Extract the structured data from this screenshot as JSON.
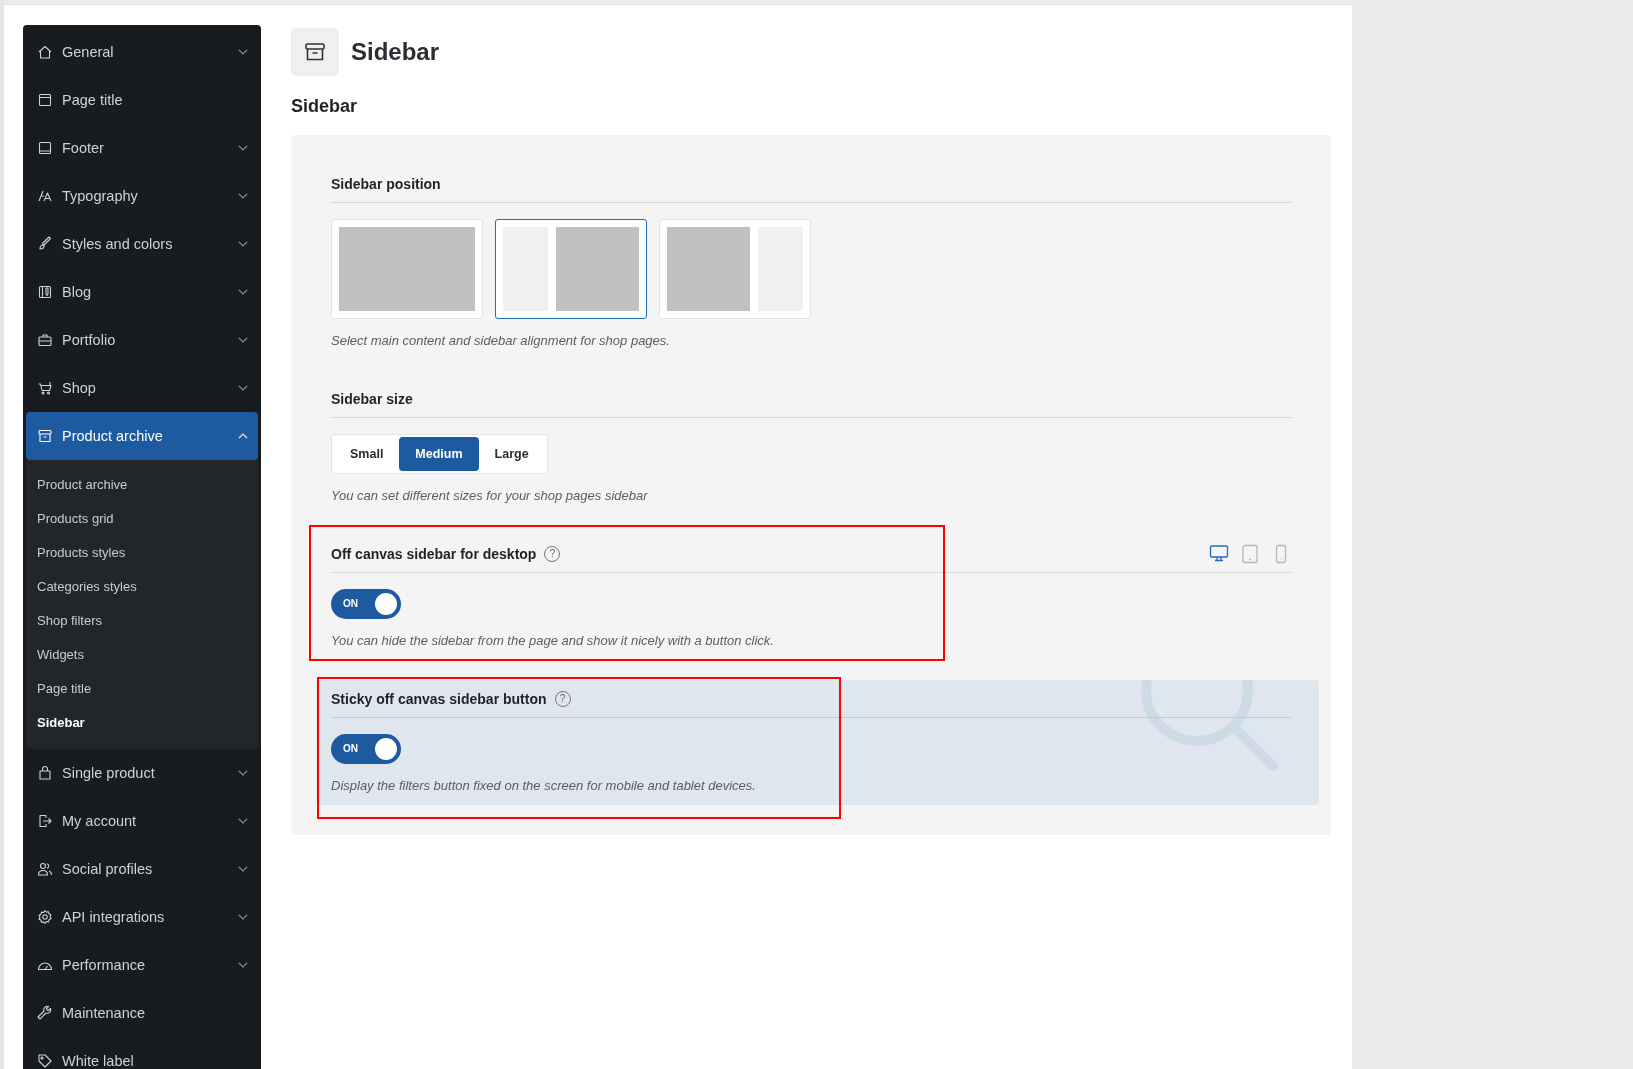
{
  "sidebar": {
    "items": [
      {
        "label": "General",
        "expandable": true,
        "expanded": false,
        "selected": false
      },
      {
        "label": "Page title",
        "expandable": false,
        "selected": false
      },
      {
        "label": "Footer",
        "expandable": true,
        "expanded": false,
        "selected": false
      },
      {
        "label": "Typography",
        "expandable": true,
        "expanded": false,
        "selected": false
      },
      {
        "label": "Styles and colors",
        "expandable": true,
        "expanded": false,
        "selected": false
      },
      {
        "label": "Blog",
        "expandable": true,
        "expanded": false,
        "selected": false
      },
      {
        "label": "Portfolio",
        "expandable": true,
        "expanded": false,
        "selected": false
      },
      {
        "label": "Shop",
        "expandable": true,
        "expanded": false,
        "selected": false
      },
      {
        "label": "Product archive",
        "expandable": true,
        "expanded": true,
        "selected": true,
        "children": [
          {
            "label": "Product archive",
            "selected": false
          },
          {
            "label": "Products grid",
            "selected": false
          },
          {
            "label": "Products styles",
            "selected": false
          },
          {
            "label": "Categories styles",
            "selected": false
          },
          {
            "label": "Shop filters",
            "selected": false
          },
          {
            "label": "Widgets",
            "selected": false
          },
          {
            "label": "Page title",
            "selected": false
          },
          {
            "label": "Sidebar",
            "selected": true
          }
        ]
      },
      {
        "label": "Single product",
        "expandable": true,
        "expanded": false,
        "selected": false
      },
      {
        "label": "My account",
        "expandable": true,
        "expanded": false,
        "selected": false
      },
      {
        "label": "Social profiles",
        "expandable": true,
        "expanded": false,
        "selected": false
      },
      {
        "label": "API integrations",
        "expandable": true,
        "expanded": false,
        "selected": false
      },
      {
        "label": "Performance",
        "expandable": true,
        "expanded": false,
        "selected": false
      },
      {
        "label": "Maintenance",
        "expandable": false,
        "selected": false
      },
      {
        "label": "White label",
        "expandable": false,
        "selected": false
      }
    ]
  },
  "page": {
    "title": "Sidebar",
    "section_title": "Sidebar"
  },
  "settings": [
    {
      "kind": "layout",
      "label": "Sidebar position",
      "options": [
        {
          "kind": "full",
          "selected": false
        },
        {
          "kind": "left",
          "selected": true
        },
        {
          "kind": "right",
          "selected": false
        }
      ],
      "description": "Select main content and sidebar alignment for shop pages."
    },
    {
      "kind": "segmented",
      "label": "Sidebar size",
      "options": [
        {
          "label": "Small",
          "selected": false
        },
        {
          "label": "Medium",
          "selected": true
        },
        {
          "label": "Large",
          "selected": false
        }
      ],
      "description": "You can set different sizes for your shop pages sidebar"
    },
    {
      "kind": "toggle",
      "label": "Off canvas sidebar for desktop",
      "help": "?",
      "highlighted": true,
      "tinted": false,
      "devices": [
        {
          "kind": "desktop",
          "selected": true
        },
        {
          "kind": "tablet",
          "selected": false
        },
        {
          "kind": "mobile",
          "selected": false
        }
      ],
      "toggle": {
        "on": true,
        "label": "ON"
      },
      "description": "You can hide the sidebar from the page and show it nicely with a button click."
    },
    {
      "kind": "toggle",
      "label": "Sticky off canvas sidebar button",
      "help": "?",
      "highlighted": true,
      "tinted": true,
      "toggle": {
        "on": true,
        "label": "ON"
      },
      "description": "Display the filters button fixed on the screen for mobile and tablet devices."
    }
  ]
}
